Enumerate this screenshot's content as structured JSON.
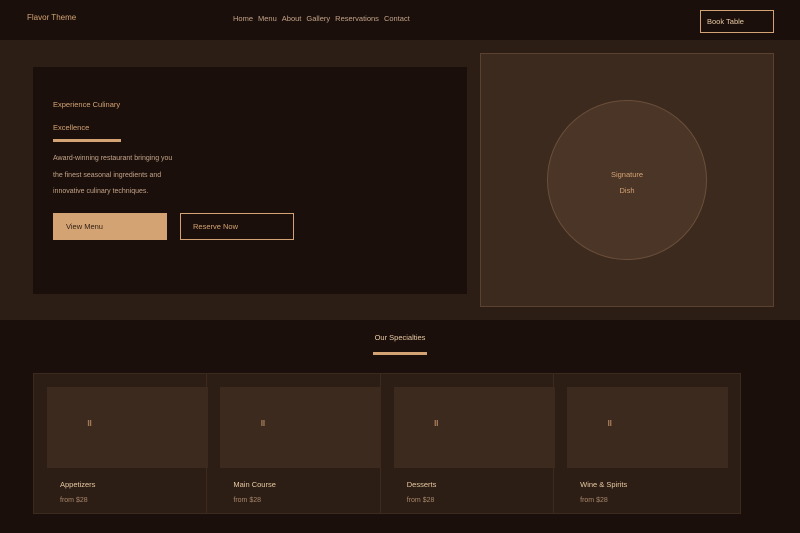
{
  "header": {
    "brand": "Flavor Theme",
    "nav": [
      "Home",
      "Menu",
      "About",
      "Gallery",
      "Reservations",
      "Contact"
    ],
    "cta_label": "Book Table"
  },
  "hero": {
    "title_line1": "Experience Culinary",
    "title_line2": "Excellence",
    "desc_line1": "Award-winning restaurant bringing you",
    "desc_line2": "the finest seasonal ingredients and",
    "desc_line3": "innovative culinary techniques.",
    "primary_label": "View Menu",
    "secondary_label": "Reserve Now",
    "image_label_line1": "Signature",
    "image_label_line2": "Dish"
  },
  "specialties": {
    "title": "Our Specialties",
    "items": [
      {
        "icon": "⠿",
        "name": "Appetizers",
        "price": "from $28"
      },
      {
        "icon": "⠿",
        "name": "Main Course",
        "price": "from $28"
      },
      {
        "icon": "⠿",
        "name": "Desserts",
        "price": "from $28"
      },
      {
        "icon": "⠿",
        "name": "Wine & Spirits",
        "price": "from $28"
      }
    ]
  },
  "colors": {
    "background": "#1a0f0b",
    "surface": "#2d1e15",
    "accent": "#d4a373"
  }
}
